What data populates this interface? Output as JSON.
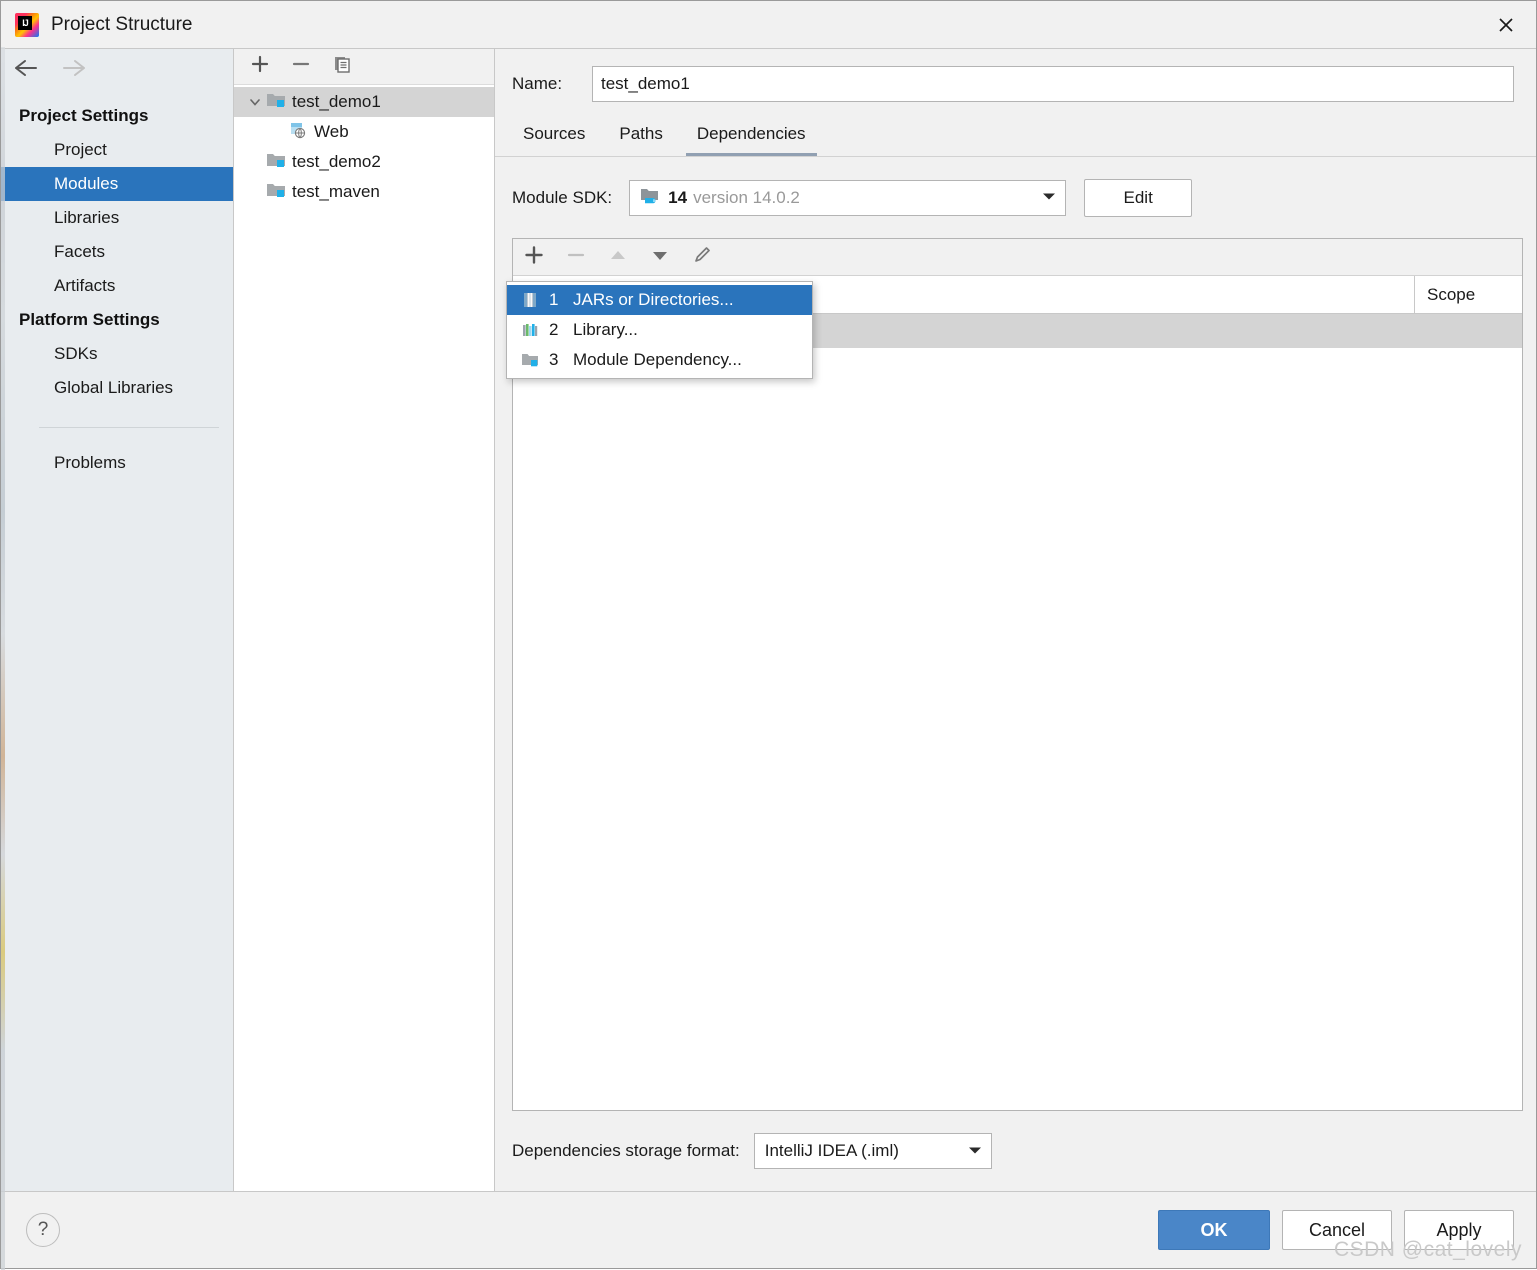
{
  "window": {
    "title": "Project Structure",
    "logo_icon": "intellij-idea-logo",
    "close_icon": "close-icon"
  },
  "nav": {
    "back_icon": "arrow-left-icon",
    "forward_icon": "arrow-right-icon"
  },
  "sidebar": {
    "groups": [
      {
        "label": "Project Settings",
        "items": [
          {
            "label": "Project",
            "selected": false
          },
          {
            "label": "Modules",
            "selected": true
          },
          {
            "label": "Libraries",
            "selected": false
          },
          {
            "label": "Facets",
            "selected": false
          },
          {
            "label": "Artifacts",
            "selected": false
          }
        ]
      },
      {
        "label": "Platform Settings",
        "items": [
          {
            "label": "SDKs",
            "selected": false
          },
          {
            "label": "Global Libraries",
            "selected": false
          }
        ]
      }
    ],
    "extra": {
      "label": "Problems"
    },
    "selected_color": "#2a74bc"
  },
  "tree": {
    "toolbar": [
      {
        "name": "add-module-button",
        "icon": "plus-icon"
      },
      {
        "name": "remove-module-button",
        "icon": "minus-icon"
      },
      {
        "name": "copy-module-button",
        "icon": "copy-icon"
      }
    ],
    "nodes": [
      {
        "label": "test_demo1",
        "icon": "module-icon",
        "depth": 0,
        "expandable": true,
        "expanded": true,
        "selected": true
      },
      {
        "label": "Web",
        "icon": "web-facet-icon",
        "depth": 1,
        "expandable": false,
        "expanded": false,
        "selected": false
      },
      {
        "label": "test_demo2",
        "icon": "module-icon",
        "depth": 0,
        "expandable": false,
        "expanded": false,
        "selected": false
      },
      {
        "label": "test_maven",
        "icon": "module-icon",
        "depth": 0,
        "expandable": false,
        "expanded": false,
        "selected": false
      }
    ]
  },
  "main": {
    "name_label": "Name:",
    "name_value": "test_demo1",
    "name_placeholder": "",
    "tabs": [
      {
        "label": "Sources",
        "active": false
      },
      {
        "label": "Paths",
        "active": false
      },
      {
        "label": "Dependencies",
        "active": true
      }
    ],
    "sdk": {
      "label": "Module SDK:",
      "icon": "jdk-icon",
      "value_strong": "14",
      "value_dim": "version 14.0.2",
      "caret_icon": "chevron-down-icon",
      "edit_button": "Edit"
    },
    "dep_toolbar": [
      {
        "name": "add-dependency-button",
        "icon": "plus-icon",
        "enabled": true
      },
      {
        "name": "remove-dependency-button",
        "icon": "minus-icon",
        "enabled": false
      },
      {
        "name": "move-up-button",
        "icon": "arrow-up-icon",
        "enabled": false
      },
      {
        "name": "move-down-button",
        "icon": "arrow-down-icon",
        "enabled": true
      },
      {
        "name": "edit-dependency-button",
        "icon": "pencil-icon",
        "enabled": true
      }
    ],
    "dep_table": {
      "columns": [
        "",
        "Scope"
      ],
      "rows": [
        {
          "name": "",
          "scope": "",
          "selected": true
        }
      ]
    },
    "storage": {
      "label": "Dependencies storage format:",
      "value": "IntelliJ IDEA (.iml)",
      "caret_icon": "chevron-down-icon"
    }
  },
  "add_menu": {
    "items": [
      {
        "number": "1",
        "label": "JARs or Directories...",
        "icon": "jar-icon",
        "highlighted": true
      },
      {
        "number": "2",
        "label": "Library...",
        "icon": "library-icon",
        "highlighted": false
      },
      {
        "number": "3",
        "label": "Module Dependency...",
        "icon": "module-icon",
        "highlighted": false
      }
    ]
  },
  "footer": {
    "help_label": "?",
    "help_icon": "help-icon",
    "buttons": [
      {
        "label": "OK",
        "primary": true
      },
      {
        "label": "Cancel",
        "primary": false
      },
      {
        "label": "Apply",
        "primary": false
      }
    ]
  },
  "watermark": "CSDN @cat_lovely"
}
